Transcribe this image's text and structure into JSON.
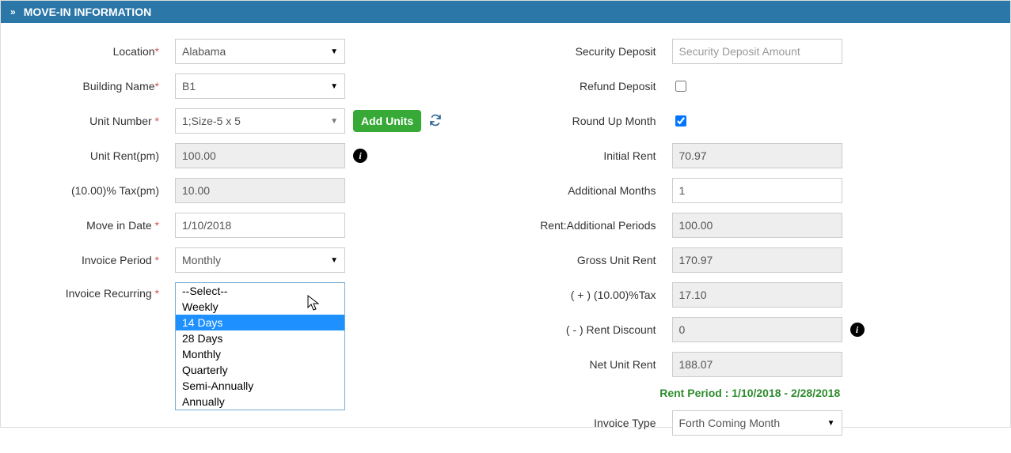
{
  "header": {
    "title": "MOVE-IN INFORMATION"
  },
  "left": {
    "location_label": "Location",
    "location_value": "Alabama",
    "building_label": "Building Name",
    "building_value": "B1",
    "unit_number_label": "Unit Number ",
    "unit_number_value": "1;Size-5  x  5",
    "add_units_btn": "Add Units",
    "unit_rent_label": "Unit Rent(pm)",
    "unit_rent_value": "100.00",
    "tax_label": "(10.00)% Tax(pm)",
    "tax_value": "10.00",
    "move_in_label": "Move in Date ",
    "move_in_value": "1/10/2018",
    "invoice_period_label": "Invoice Period ",
    "invoice_period_value": "Monthly",
    "invoice_recurring_label": "Invoice Recurring ",
    "dropdown_options": [
      "--Select--",
      "Weekly",
      "14 Days",
      "28 Days",
      "Monthly",
      "Quarterly",
      "Semi-Annually",
      "Annually"
    ],
    "dropdown_highlight_index": 2
  },
  "right": {
    "sec_dep_label": "Security Deposit",
    "sec_dep_placeholder": "Security Deposit Amount",
    "refund_label": "Refund Deposit",
    "refund_checked": false,
    "roundup_label": "Round Up Month",
    "roundup_checked": true,
    "initial_rent_label": "Initial Rent",
    "initial_rent_value": "70.97",
    "add_months_label": "Additional Months",
    "add_months_value": "1",
    "rent_add_periods_label": "Rent:Additional Periods",
    "rent_add_periods_value": "100.00",
    "gross_label": "Gross Unit Rent",
    "gross_value": "170.97",
    "plus_tax_label": "( + ) (10.00)%Tax",
    "plus_tax_value": "17.10",
    "discount_label": "( - ) Rent Discount",
    "discount_value": "0",
    "net_label": "Net Unit Rent",
    "net_value": "188.07",
    "rent_period_text": "Rent Period : 1/10/2018 - 2/28/2018",
    "invoice_type_label": "Invoice Type",
    "invoice_type_value": "Forth Coming Month"
  }
}
